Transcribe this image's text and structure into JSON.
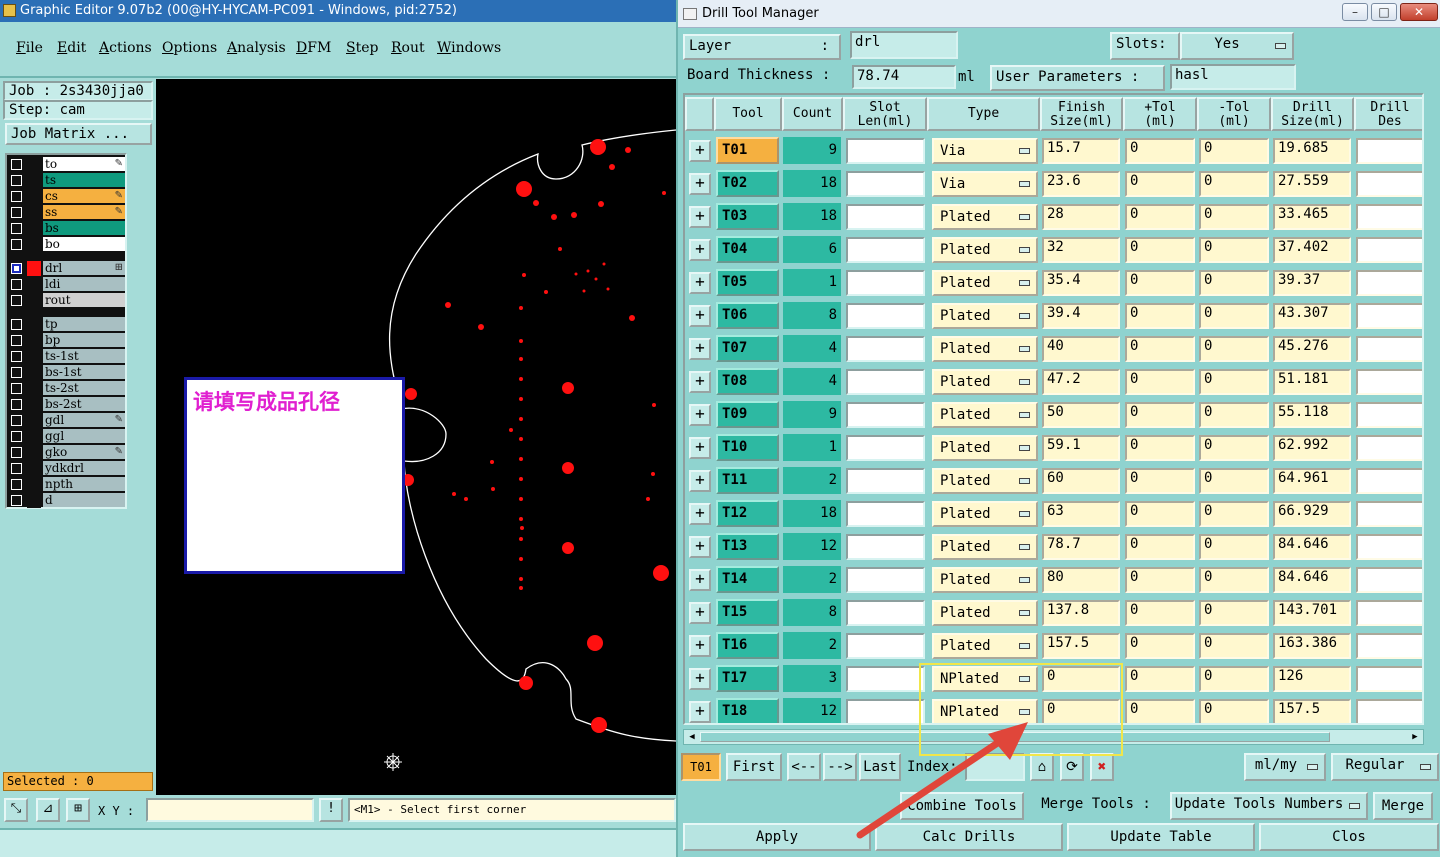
{
  "graphic_editor": {
    "title": "Graphic Editor 9.07b2 (00@HY-HYCAM-PC091 - Windows, pid:2752)",
    "menu": [
      "File",
      "Edit",
      "Actions",
      "Options",
      "Analysis",
      "DFM",
      "Step",
      "Rout",
      "Windows"
    ],
    "job_label": "Job : 2s3430jja0",
    "step_label": "Step: cam",
    "job_matrix_button": "Job Matrix ...",
    "layers": [
      {
        "name": "to",
        "color": "#ffffff",
        "mark": "pencil"
      },
      {
        "name": "ts",
        "color": "#0f9a7e",
        "mark": ""
      },
      {
        "name": "cs",
        "color": "#f5b040",
        "mark": "pencil"
      },
      {
        "name": "ss",
        "color": "#f5b040",
        "mark": "pencil"
      },
      {
        "name": "bs",
        "color": "#0f9a7e",
        "mark": ""
      },
      {
        "name": "bo",
        "color": "#ffffff",
        "mark": ""
      },
      {
        "name": "drl",
        "color": "#a8bfc2",
        "mark": "grid",
        "active": true
      },
      {
        "name": "ldi",
        "color": "#a8bfc2",
        "mark": ""
      },
      {
        "name": "rout",
        "color": "#d0d0d0",
        "mark": ""
      },
      {
        "name": "tp",
        "color": "#a8bfc2",
        "mark": ""
      },
      {
        "name": "bp",
        "color": "#a8bfc2",
        "mark": ""
      },
      {
        "name": "ts-1st",
        "color": "#a8bfc2",
        "mark": ""
      },
      {
        "name": "bs-1st",
        "color": "#a8bfc2",
        "mark": ""
      },
      {
        "name": "ts-2st",
        "color": "#a8bfc2",
        "mark": ""
      },
      {
        "name": "bs-2st",
        "color": "#a8bfc2",
        "mark": ""
      },
      {
        "name": "gdl",
        "color": "#a8bfc2",
        "mark": "pencil"
      },
      {
        "name": "ggl",
        "color": "#a8bfc2",
        "mark": ""
      },
      {
        "name": "gko",
        "color": "#a8bfc2",
        "mark": "pencil"
      },
      {
        "name": "ydkdrl",
        "color": "#a8bfc2",
        "mark": ""
      },
      {
        "name": "npth",
        "color": "#a8bfc2",
        "mark": ""
      },
      {
        "name": "d",
        "color": "#a8bfc2",
        "mark": ""
      }
    ],
    "canvas_note": "请填写成品孔径",
    "selected_label": "Selected : 0",
    "xy_label": "X Y :",
    "message": "<M1> - Select first corner"
  },
  "drill_tool_manager": {
    "title": "Drill Tool Manager",
    "layer_label": "Layer",
    "layer_value": "drl",
    "slots_label": "Slots:",
    "slots_value": "Yes",
    "board_thickness_label": "Board Thickness :",
    "board_thickness_value": "78.74",
    "board_thickness_unit": "ml",
    "user_params_label": "User Parameters :",
    "user_params_value": "hasl",
    "headers": {
      "tool": "Tool",
      "count": "Count",
      "slot_len": "Slot\nLen(ml)",
      "type": "Type",
      "finish": "Finish\nSize(ml)",
      "plus_tol": "+Tol\n(ml)",
      "minus_tol": "-Tol\n(ml)",
      "drill_size": "Drill\nSize(ml)",
      "drill_des": "Drill\nDes"
    },
    "rows": [
      {
        "tool": "T01",
        "count": "9",
        "type": "Via",
        "finish": "15.7",
        "plus": "0",
        "minus": "0",
        "drill": "19.685"
      },
      {
        "tool": "T02",
        "count": "18",
        "type": "Via",
        "finish": "23.6",
        "plus": "0",
        "minus": "0",
        "drill": "27.559"
      },
      {
        "tool": "T03",
        "count": "18",
        "type": "Plated",
        "finish": "28",
        "plus": "0",
        "minus": "0",
        "drill": "33.465"
      },
      {
        "tool": "T04",
        "count": "6",
        "type": "Plated",
        "finish": "32",
        "plus": "0",
        "minus": "0",
        "drill": "37.402"
      },
      {
        "tool": "T05",
        "count": "1",
        "type": "Plated",
        "finish": "35.4",
        "plus": "0",
        "minus": "0",
        "drill": "39.37"
      },
      {
        "tool": "T06",
        "count": "8",
        "type": "Plated",
        "finish": "39.4",
        "plus": "0",
        "minus": "0",
        "drill": "43.307"
      },
      {
        "tool": "T07",
        "count": "4",
        "type": "Plated",
        "finish": "40",
        "plus": "0",
        "minus": "0",
        "drill": "45.276"
      },
      {
        "tool": "T08",
        "count": "4",
        "type": "Plated",
        "finish": "47.2",
        "plus": "0",
        "minus": "0",
        "drill": "51.181"
      },
      {
        "tool": "T09",
        "count": "9",
        "type": "Plated",
        "finish": "50",
        "plus": "0",
        "minus": "0",
        "drill": "55.118"
      },
      {
        "tool": "T10",
        "count": "1",
        "type": "Plated",
        "finish": "59.1",
        "plus": "0",
        "minus": "0",
        "drill": "62.992"
      },
      {
        "tool": "T11",
        "count": "2",
        "type": "Plated",
        "finish": "60",
        "plus": "0",
        "minus": "0",
        "drill": "64.961"
      },
      {
        "tool": "T12",
        "count": "18",
        "type": "Plated",
        "finish": "63",
        "plus": "0",
        "minus": "0",
        "drill": "66.929"
      },
      {
        "tool": "T13",
        "count": "12",
        "type": "Plated",
        "finish": "78.7",
        "plus": "0",
        "minus": "0",
        "drill": "84.646"
      },
      {
        "tool": "T14",
        "count": "2",
        "type": "Plated",
        "finish": "80",
        "plus": "0",
        "minus": "0",
        "drill": "84.646"
      },
      {
        "tool": "T15",
        "count": "8",
        "type": "Plated",
        "finish": "137.8",
        "plus": "0",
        "minus": "0",
        "drill": "143.701"
      },
      {
        "tool": "T16",
        "count": "2",
        "type": "Plated",
        "finish": "157.5",
        "plus": "0",
        "minus": "0",
        "drill": "163.386"
      },
      {
        "tool": "T17",
        "count": "3",
        "type": "NPlated",
        "finish": "0",
        "plus": "0",
        "minus": "0",
        "drill": "126"
      },
      {
        "tool": "T18",
        "count": "12",
        "type": "NPlated",
        "finish": "0",
        "plus": "0",
        "minus": "0",
        "drill": "157.5"
      }
    ],
    "nav": {
      "current": "T01",
      "first": "First",
      "prev": "<--",
      "next": "-->",
      "last": "Last",
      "index_label": "Index:",
      "units": "ml/my",
      "mode": "Regular"
    },
    "actions": {
      "combine": "Combine Tools",
      "merge_label": "Merge Tools :",
      "update_numbers": "Update Tools Numbers",
      "merge": "Merge",
      "apply": "Apply",
      "calc": "Calc Drills",
      "update_table": "Update Table",
      "close": "Clos"
    }
  }
}
